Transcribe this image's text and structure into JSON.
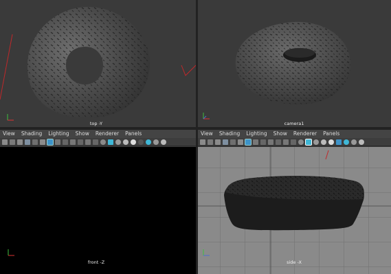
{
  "viewports": {
    "top_left": {
      "label": "top -Y"
    },
    "top_right": {
      "label": "camera1"
    },
    "bottom_left": {
      "label": "front -Z"
    },
    "bottom_right": {
      "label": "side -X"
    }
  },
  "menus": [
    "View",
    "Shading",
    "Lighting",
    "Show",
    "Renderer",
    "Panels"
  ],
  "toolbar_icons": [
    "camera-icon",
    "film-icon",
    "bookmark-icon",
    "image-plane-icon",
    "grid-view-icon",
    "transform-icon",
    "stats-icon",
    "film-gate-icon",
    "resolution-gate-icon",
    "gate-mask-icon",
    "field-chart-icon",
    "safe-action-icon",
    "safe-title-icon",
    "wireframe-icon",
    "smooth-shade-icon",
    "bounding-box-icon",
    "textures-icon",
    "lights-icon",
    "shadows-icon",
    "isolate-icon",
    "xray-icon",
    "ambient-occlusion-icon"
  ],
  "colors": {
    "viewport_bg": "#3a3a3a",
    "front_bg": "#000000",
    "side_bg": "#8a8a8a",
    "menu_bg": "#444444",
    "accent_red": "#c0282a",
    "highlight_blue": "#3d93c8"
  }
}
